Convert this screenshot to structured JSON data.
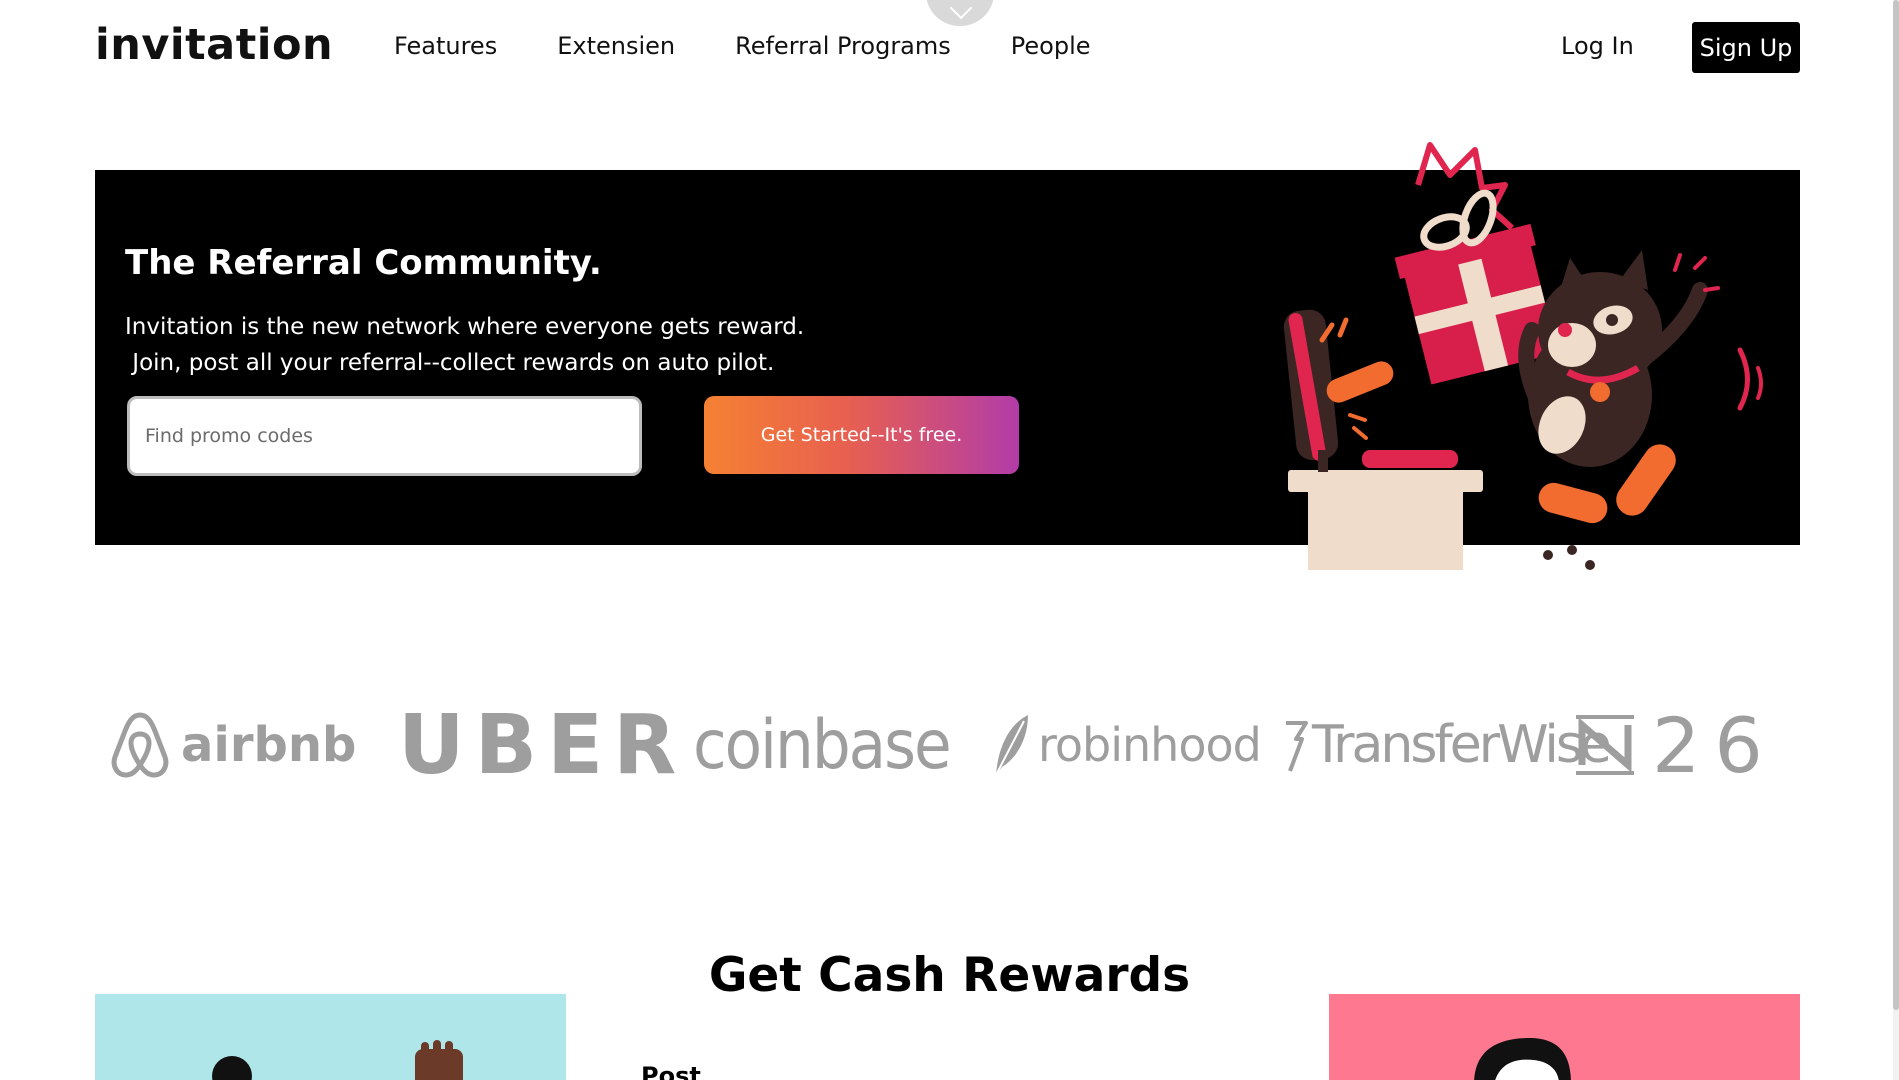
{
  "header": {
    "brand": "invitation",
    "nav": [
      "Features",
      "Extensien",
      "Referral Programs",
      "People"
    ],
    "login_label": "Log In",
    "signup_label": "Sign Up"
  },
  "hero": {
    "title": "The Referral Community.",
    "description_line1": "Invitation is the new network where everyone gets reward.",
    "description_line2": " Join, post all your referral--collect rewards on auto pilot.",
    "search_placeholder": "Find promo codes",
    "cta_label": "Get Started--It's free."
  },
  "logos": {
    "airbnb": "airbnb",
    "uber": "UBER",
    "coinbase": "coinbase",
    "robinhood": "robinhood",
    "transferwise": "TransferWise",
    "n26": "26"
  },
  "rewards": {
    "title": "Get Cash Rewards",
    "post_label": "Post"
  },
  "colors": {
    "hero_bg": "#000000",
    "cta_gradient_start": "#f58133",
    "cta_gradient_end": "#b23ca8",
    "card_left_bg": "#aee6ea",
    "card_right_bg": "#fe788f",
    "logo_gray": "#9e9e9e"
  }
}
